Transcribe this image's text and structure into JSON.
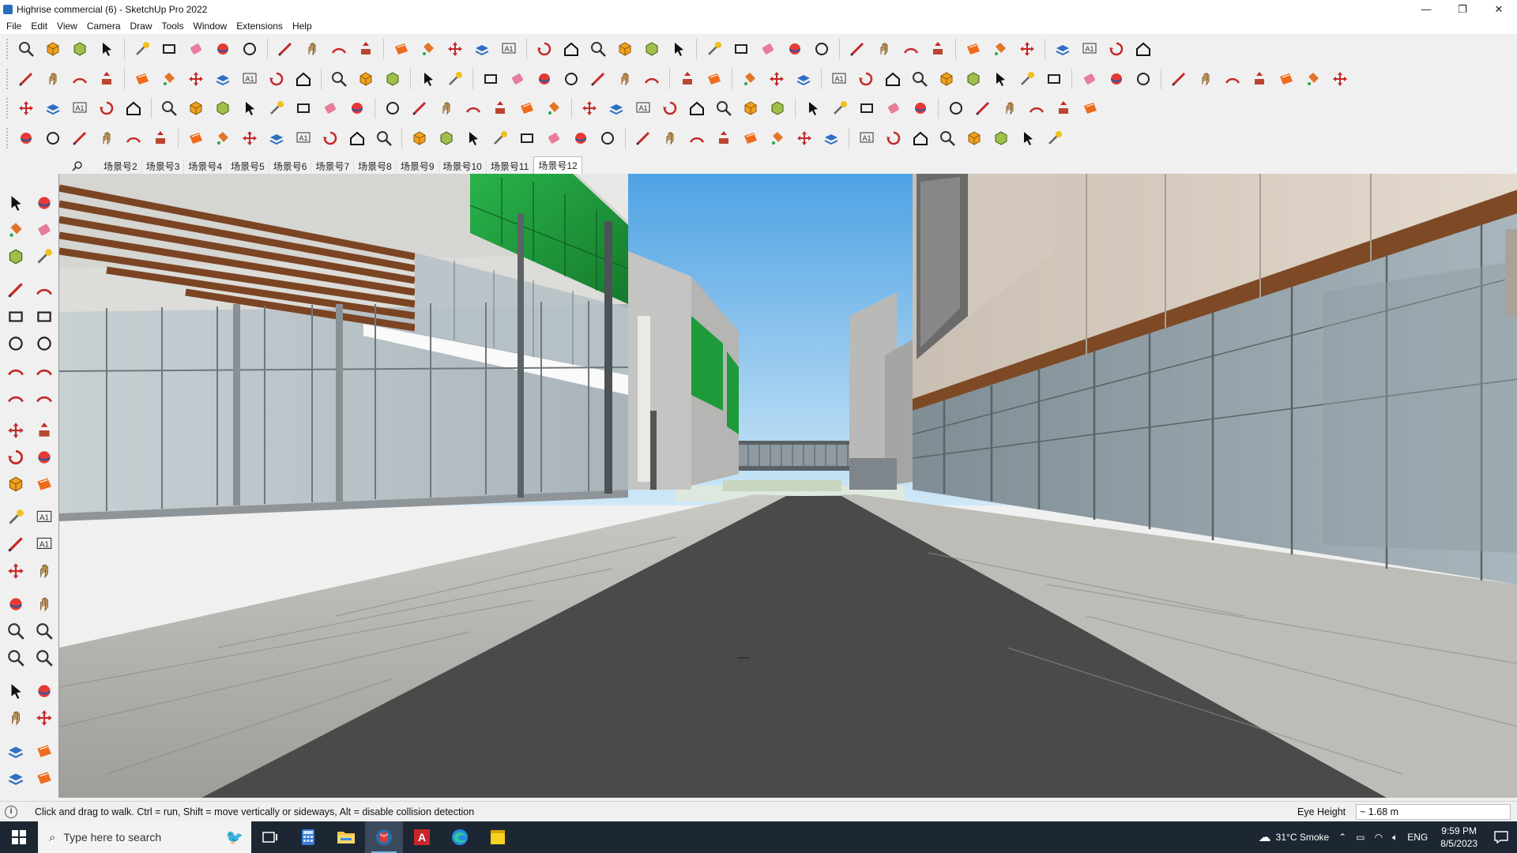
{
  "window": {
    "title": "Highrise commercial (6) - SketchUp Pro 2022",
    "minimize_label": "—",
    "maximize_label": "❐",
    "close_label": "✕"
  },
  "menu": [
    "File",
    "Edit",
    "View",
    "Camera",
    "Draw",
    "Tools",
    "Window",
    "Extensions",
    "Help"
  ],
  "scenes": {
    "tabs": [
      "场景号2",
      "场景号3",
      "场景号4",
      "场景号5",
      "场景号6",
      "场景号7",
      "场景号8",
      "场景号9",
      "场景号10",
      "场景号11",
      "场景号12"
    ],
    "active": "场景号12"
  },
  "status": {
    "hint": "Click and drag to walk.  Ctrl = run, Shift = move vertically or sideways, Alt = disable collision detection",
    "measure_label": "Eye Height",
    "measure_value": "~ 1.68 m",
    "info_icon": "i"
  },
  "taskbar": {
    "search_placeholder": "Type here to search",
    "weather": "31°C  Smoke",
    "language": "ENG",
    "time": "9:59 PM",
    "date": "8/5/2023"
  },
  "colors": {
    "sky_top": "#5aa8e6",
    "sky_bottom": "#bfe0f5",
    "road": "#4a4a4a",
    "green_panels": "#1e9a3a",
    "wood_slats": "#8a4e28",
    "accent": "#2a6ebb"
  }
}
